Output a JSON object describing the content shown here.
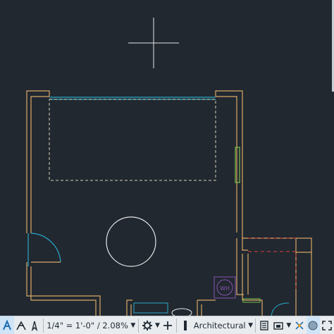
{
  "drawing": {
    "water_heater_label": "WH"
  },
  "status_bar": {
    "annotation_scale": "1/4\" = 1'-0\" / 2.08%",
    "units": "Architectural",
    "icons": [
      "model-space-icon",
      "snap-icon",
      "annotation-visibility-icon",
      "workspace-gear-icon",
      "add-icon",
      "lineweight-icon",
      "units-icon",
      "quick-properties-icon",
      "ui-lock-icon",
      "isolate-objects-icon",
      "graphics-performance-icon",
      "fullscreen-icon"
    ]
  },
  "colors": {
    "background": "#212830",
    "wall": "#d9a866",
    "glass": "#2aa8c8",
    "dashed_outline": "#d8cfb4",
    "crosshair": "#e6e6e6",
    "status_bar": "#e9ecef",
    "dashed_red": "#b83a3a",
    "purple": "#8b52b0",
    "green": "#7cc04a"
  }
}
